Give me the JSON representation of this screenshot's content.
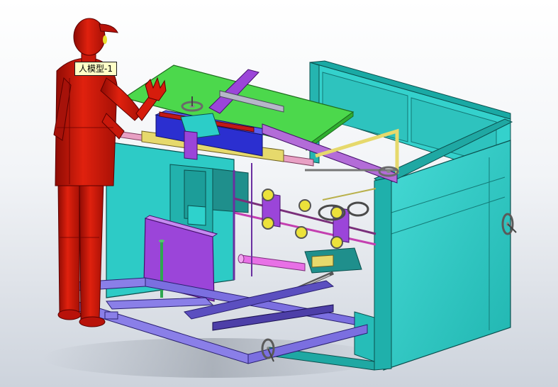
{
  "viewport": {
    "background_top": "#ffffff",
    "background_bottom": "#cdd3dc"
  },
  "tooltip": {
    "label": "人模型-1"
  },
  "colors": {
    "human": "#dd1a0a",
    "frame_cyan": "#2ccdc8",
    "table_green": "#4cd84c",
    "beam_purple": "#9b45d9",
    "base_lavender": "#8a7fe8",
    "blue_block": "#2b2fd0",
    "yellow_rail": "#e6d96c",
    "roller_yellow": "#ece23a",
    "pink_rod": "#e870e6",
    "dark_cyan_block": "#1f8f8c"
  },
  "icons": {
    "handwheel": "handwheel-icon",
    "roller": "roller-icon"
  }
}
